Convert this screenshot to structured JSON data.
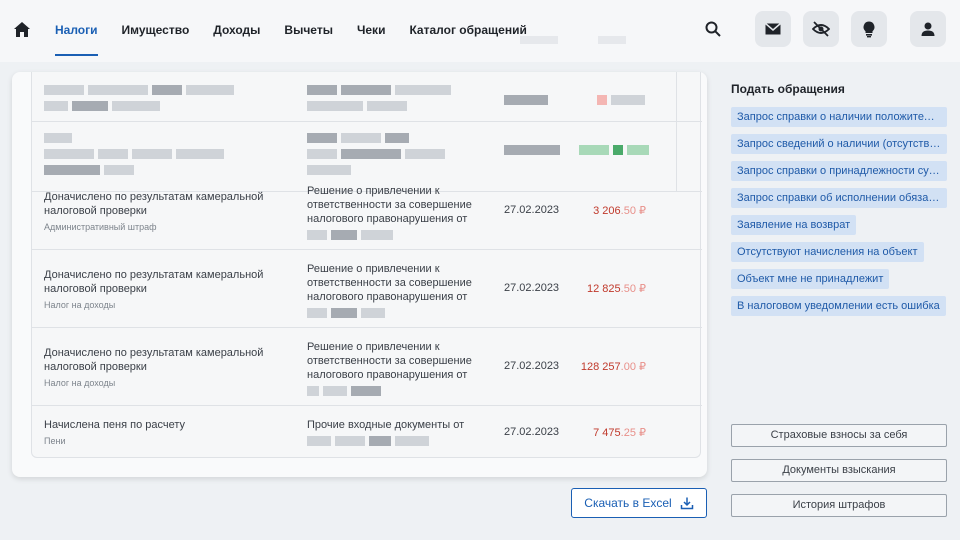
{
  "nav": {
    "items": [
      {
        "label": "Налоги",
        "active": true
      },
      {
        "label": "Имущество",
        "active": false
      },
      {
        "label": "Доходы",
        "active": false
      },
      {
        "label": "Вычеты",
        "active": false
      },
      {
        "label": "Чеки",
        "active": false
      },
      {
        "label": "Каталог обращений",
        "active": false
      }
    ]
  },
  "top_icons": [
    "home-icon",
    "search-icon",
    "mail-icon",
    "eye-off-icon",
    "lightbulb-icon",
    "user-icon"
  ],
  "rows": [
    {
      "description": "Доначислено по результатам камеральной налоговой проверки",
      "category": "Административный штраф",
      "document": "Решение о привлечении к ответственности за совершение налогового правонарушения от",
      "date": "27.02.2023",
      "amount_main": "3 206",
      "amount_kop": ".50 ₽"
    },
    {
      "description": "Доначислено по результатам камеральной налоговой проверки",
      "category": "Налог на доходы",
      "document": "Решение о привлечении к ответственности за совершение налогового правонарушения от",
      "date": "27.02.2023",
      "amount_main": "12 825",
      "amount_kop": ".50 ₽"
    },
    {
      "description": "Доначислено по результатам камеральной налоговой проверки",
      "category": "Налог на доходы",
      "document": "Решение о привлечении к ответственности за совершение налогового правонарушения от",
      "date": "27.02.2023",
      "amount_main": "128 257",
      "amount_kop": ".00 ₽"
    },
    {
      "description": "Начислена пеня по расчету",
      "category": "Пени",
      "document": "Прочие входные документы от",
      "date": "27.02.2023",
      "amount_main": "7 475",
      "amount_kop": ".25 ₽"
    }
  ],
  "export_button": {
    "label": "Скачать в Excel",
    "icon": "download-icon"
  },
  "sidebar": {
    "title": "Подать обращения",
    "requests": [
      "Запрос справки о наличии положительного сальдо",
      "Запрос сведений о наличии (отсутствии) задолженности",
      "Запрос справки о принадлежности сумм",
      "Запрос справки об исполнении обязанности",
      "Заявление на возврат",
      "Отсутствуют начисления на объект",
      "Объект мне не принадлежит",
      "В налоговом уведомлении есть ошибка"
    ],
    "buttons": [
      "Страховые взносы за себя",
      "Документы взыскания",
      "История штрафов"
    ]
  },
  "colors": {
    "accent": "#1a5fb4",
    "amount": "#c0392b",
    "chip_bg": "#d2e1f4"
  }
}
